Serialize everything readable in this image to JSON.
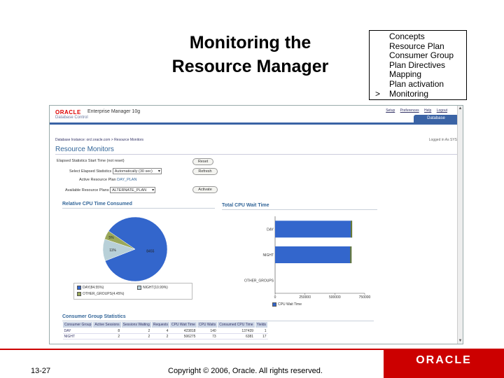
{
  "slide": {
    "title_line1": "Monitoring the",
    "title_line2": "Resource Manager",
    "topics": [
      "Concepts",
      "Resource Plan",
      "Consumer Group",
      "Plan Directives",
      "Mapping",
      "Plan activation"
    ],
    "active_marker": ">",
    "active_topic": "Monitoring",
    "slide_number": "13-27",
    "copyright": "Copyright © 2006, Oracle. All rights reserved.",
    "logo_text": "ORACLE"
  },
  "em": {
    "oracle_text": "ORACLE",
    "product": "Enterprise Manager 10g",
    "db_control": "Database Control",
    "links": [
      "Setup",
      "Preferences",
      "Help",
      "Logout"
    ],
    "db_tab": "Database",
    "breadcrumb": "Database Instance: orcl.oracle.com > Resource Monitors",
    "logged_in": "Logged in As SYS",
    "page_heading": "Resource Monitors",
    "form": {
      "start_label": "Elapsed Statistics Start Time (not reset)",
      "reset_btn": "Reset",
      "stat_label": "Select Elapsed Statistics",
      "stat_value": "Automatically (30 sec)",
      "refresh_btn": "Refresh",
      "active_plan_label": "Active Resource Plan",
      "active_plan_value": "DAY_PLAN",
      "avail_label": "Available Resource Plans",
      "avail_value": "ALTERNATE_PLAN",
      "activate_btn": "Activate"
    }
  },
  "chart_data": [
    {
      "type": "pie",
      "title": "Relative CPU Time Consumed",
      "labels": [
        "DAY",
        "NIGHT",
        "OTHER_GROUPS"
      ],
      "values": [
        84.55,
        11.0,
        4.45
      ],
      "slice_labels": [
        "8455",
        "11%",
        "5%"
      ],
      "colors": [
        "#3366cc",
        "#b8d0d8",
        "#9aa85a"
      ],
      "legend": [
        "DAY(84.55%)",
        "NIGHT(10.99%)",
        "OTHER_GROUPS(4.45%)"
      ]
    },
    {
      "type": "bar",
      "title": "Total CPU Wait Time",
      "orientation": "horizontal",
      "categories": [
        "DAY",
        "NIGHT",
        "OTHER_GROUPS"
      ],
      "values": [
        645000,
        640000,
        0
      ],
      "xlim": [
        0,
        750000
      ],
      "ticks": [
        "0",
        "250000",
        "500000",
        "750000"
      ],
      "legend": [
        "CPU Wait Time"
      ],
      "colors": [
        "#3366cc",
        "#6a7a32"
      ]
    }
  ],
  "stats": {
    "title": "Consumer Group Statistics",
    "columns": [
      "Consumer Group",
      "Active Sessions",
      "Sessions Waiting",
      "Requests",
      "CPU Wait Time",
      "CPU Waits",
      "Consumed CPU Time",
      "Yields"
    ],
    "rows": [
      [
        "DAY",
        "8",
        "2",
        "4",
        "423818",
        "140",
        "137439",
        "1"
      ],
      [
        "NIGHT",
        "2",
        "2",
        "2",
        "506275",
        "73",
        "6381",
        "17"
      ]
    ]
  }
}
